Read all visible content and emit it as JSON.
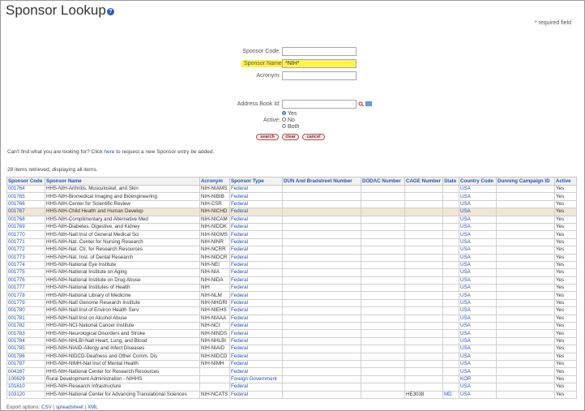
{
  "title": "Sponsor Lookup",
  "required_note": "* required field",
  "form": {
    "sponsor_code_label": "Sponsor Code:",
    "sponsor_code_value": "",
    "sponsor_name_label": "Sponsor Name:",
    "sponsor_name_value": "*NIH*",
    "acronym_label": "Acronym:",
    "acronym_value": "",
    "address_book_label": "Address Book Id:",
    "address_book_value": "",
    "active_label": "Active:",
    "active_options": [
      "Yes",
      "No",
      "Both"
    ],
    "active_selected": "Yes"
  },
  "buttons": {
    "search": "search",
    "clear": "clear",
    "cancel": "cancel"
  },
  "help_text_pre": "Can't find what you are looking for? Click ",
  "help_link": "here",
  "help_text_post": " to request a new Sponsor entry be added.",
  "result_summary": "28 items retrieved, displaying all items.",
  "table": {
    "headers": [
      "Sponsor Code",
      "Sponsor Name",
      "Acronym",
      "Sponsor Type",
      "DUN And Bradstreet Number",
      "DODAC Number",
      "CAGE Number",
      "State",
      "Country Code",
      "Dunning Campaign ID",
      "Active"
    ],
    "rows": [
      [
        "001764",
        "HHS-NIH-Arthritis, Musculoskel, and Skin",
        "NIH-NIAMS",
        "Federal",
        "",
        "",
        "",
        "",
        "USA",
        "",
        "Yes"
      ],
      [
        "001765",
        "HHS-NIH-Biomedical Imaging and Bioengineering",
        "NIH-NIBIB",
        "Federal",
        "",
        "",
        "",
        "",
        "USA",
        "",
        "Yes"
      ],
      [
        "001766",
        "HHS-NIH-Center for Scientific Review",
        "NIH-CSR",
        "Federal",
        "",
        "",
        "",
        "",
        "USA",
        "",
        "Yes"
      ],
      [
        "001767",
        "HHS-NIH-Child Health and Human Develop",
        "NIH-NICHD",
        "Federal",
        "",
        "",
        "",
        "",
        "USA",
        "",
        "Yes"
      ],
      [
        "001768",
        "HHS-NIH-Complimentary and Alternative Med",
        "NIH-NICAM",
        "Federal",
        "",
        "",
        "",
        "",
        "USA",
        "",
        "Yes"
      ],
      [
        "001769",
        "HHS-NIH-Diabetes, Digestive, and Kidney",
        "NIH-NIDDK",
        "Federal",
        "",
        "",
        "",
        "",
        "USA",
        "",
        "Yes"
      ],
      [
        "001770",
        "HHS-NIH-Natl Inst of General Medical Sci",
        "NIH-NIGMS",
        "Federal",
        "",
        "",
        "",
        "",
        "USA",
        "",
        "Yes"
      ],
      [
        "001771",
        "HHS-NIH-Nat. Center for Nursing Research",
        "NIH-NINR",
        "Federal",
        "",
        "",
        "",
        "",
        "USA",
        "",
        "Yes"
      ],
      [
        "001772",
        "HHS-NIH-Nat. Ctr. for Research Resources",
        "NIH-NCRR",
        "Federal",
        "",
        "",
        "",
        "",
        "USA",
        "",
        "Yes"
      ],
      [
        "001773",
        "HHS-NIH-Nat. Inst. of Dental Research",
        "NIH-NIDCR",
        "Federal",
        "",
        "",
        "",
        "",
        "USA",
        "",
        "Yes"
      ],
      [
        "001774",
        "HHS-NIH-National Eye Institute",
        "NIH-NEI",
        "Federal",
        "",
        "",
        "",
        "",
        "USA",
        "",
        "Yes"
      ],
      [
        "001775",
        "HHS-NIH-National Institute on Aging",
        "NIH-NIA",
        "Federal",
        "",
        "",
        "",
        "",
        "USA",
        "",
        "Yes"
      ],
      [
        "001776",
        "HHS-NIH-National Institute on Drug Abuse",
        "NIH-NIDA",
        "Federal",
        "",
        "",
        "",
        "",
        "USA",
        "",
        "Yes"
      ],
      [
        "001777",
        "HHS-NIH-National Institutes of Health",
        "NIH",
        "Federal",
        "",
        "",
        "",
        "",
        "USA",
        "",
        "Yes"
      ],
      [
        "001778",
        "HHS-NIH-National Library of Medicine",
        "NIH-NLM",
        "Federal",
        "",
        "",
        "",
        "",
        "USA",
        "",
        "Yes"
      ],
      [
        "001779",
        "HHS-NIH-Natl Genome Research Institute",
        "NIH-NHGRI",
        "Federal",
        "",
        "",
        "",
        "",
        "USA",
        "",
        "Yes"
      ],
      [
        "001780",
        "HHS-NIH-Natl Inst of Environ Health Serv",
        "NIH-NIEHS",
        "Federal",
        "",
        "",
        "",
        "",
        "USA",
        "",
        "Yes"
      ],
      [
        "001781",
        "HHS-NIH-Natl Inst on Alcohol Abuse",
        "NIH-NIAAA",
        "Federal",
        "",
        "",
        "",
        "",
        "USA",
        "",
        "Yes"
      ],
      [
        "001782",
        "HHS-NIH-NCI-National Cancer Institute",
        "NIH-NCI",
        "Federal",
        "",
        "",
        "",
        "",
        "USA",
        "",
        "Yes"
      ],
      [
        "001783",
        "HHS-NIH-Neurological Disorders and Stroke",
        "NIH-NINDS",
        "Federal",
        "",
        "",
        "",
        "",
        "USA",
        "",
        "Yes"
      ],
      [
        "001784",
        "HHS-NIH-NHLBI-Natl Heart, Lung, and Blood",
        "NIH-NHLBI",
        "Federal",
        "",
        "",
        "",
        "",
        "USA",
        "",
        "Yes"
      ],
      [
        "001785",
        "HHS-NIH-NIAID-Allergy and Infect Diseases",
        "NIH-NIAID",
        "Federal",
        "",
        "",
        "",
        "",
        "USA",
        "",
        "Yes"
      ],
      [
        "001786",
        "HHS-NIH-NIDCD-Deafness and Other Comm. Dis",
        "NIH-NIDCD",
        "Federal",
        "",
        "",
        "",
        "",
        "USA",
        "",
        "Yes"
      ],
      [
        "001787",
        "HHS-NIH-NIMH-Nat Inst of Mental Health",
        "NIH-NIMH",
        "Federal",
        "",
        "",
        "",
        "",
        "USA",
        "",
        "Yes"
      ],
      [
        "004167",
        "HHS-NIH-National Center for Research Resources",
        "",
        "Federal",
        "",
        "",
        "",
        "",
        "USA",
        "",
        "Yes"
      ],
      [
        "100629",
        "Rural Development Administration - NIHHS",
        "",
        "Foreign Government",
        "",
        "",
        "",
        "",
        "KOR",
        "",
        "Yes"
      ],
      [
        "101610",
        "HHS-NIH-Research Infrastructure",
        "",
        "Federal",
        "",
        "",
        "",
        "",
        "USA",
        "",
        "Yes"
      ],
      [
        "103120",
        "HHS-NIH-National Center for Advancing Translational Sciences",
        "NIH-NCATS",
        "Federal",
        "",
        "",
        "HE3038",
        "MD",
        "USA",
        "",
        "Yes"
      ]
    ],
    "highlighted_row": 3
  },
  "export": {
    "label": "Export options:",
    "csv": "CSV",
    "spreadsheet": "spreadsheet",
    "xml": "XML",
    "sep": "|"
  },
  "colors": {
    "link": "#2451b3",
    "highlight": "#fff34d",
    "row_hover": "#efe6d6"
  }
}
